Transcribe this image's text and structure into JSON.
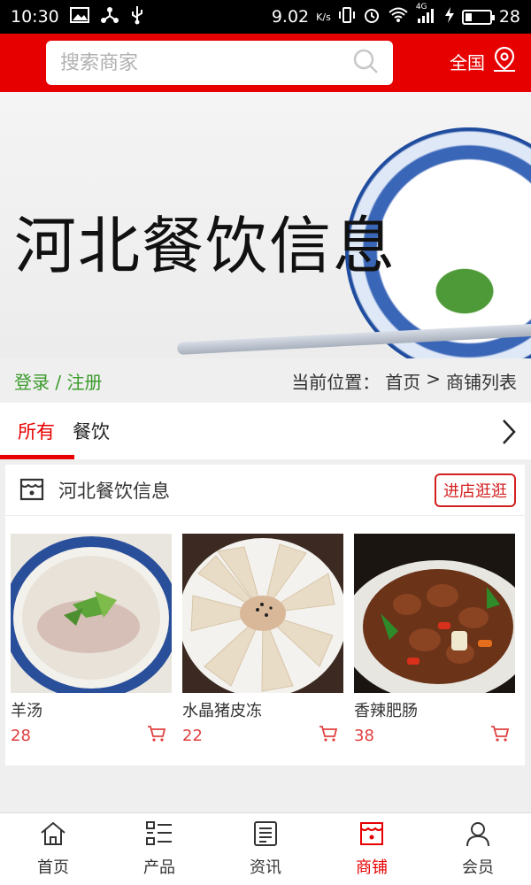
{
  "status_bar": {
    "time": "10:30",
    "speed": "9.02",
    "speed_unit": "K/s",
    "network": "4G",
    "battery": "28",
    "battery_level": 0.28
  },
  "header": {
    "search_placeholder": "搜索商家",
    "region_label": "全国"
  },
  "banner": {
    "title": "河北餐饮信息"
  },
  "breadcrumb": {
    "login_label": "登录 / 注册",
    "prefix": "当前位置：",
    "home": "首页",
    "separator": ">",
    "current": "商铺列表"
  },
  "tabs": [
    {
      "label": "所有",
      "active": true
    },
    {
      "label": "餐饮",
      "active": false
    }
  ],
  "shop": {
    "name": "河北餐饮信息",
    "enter_label": "进店逛逛",
    "products": [
      {
        "name": "羊汤",
        "price": "28",
        "image": "mutton-soup"
      },
      {
        "name": "水晶猪皮冻",
        "price": "22",
        "image": "pork-skin-jelly"
      },
      {
        "name": "香辣肥肠",
        "price": "38",
        "image": "spicy-intestines"
      }
    ]
  },
  "bottom_nav": [
    {
      "label": "首页",
      "icon": "home-icon",
      "active": false
    },
    {
      "label": "产品",
      "icon": "list-icon",
      "active": false
    },
    {
      "label": "资讯",
      "icon": "news-icon",
      "active": false
    },
    {
      "label": "商铺",
      "icon": "store-icon",
      "active": true
    },
    {
      "label": "会员",
      "icon": "user-icon",
      "active": false
    }
  ],
  "colors": {
    "brand": "#e60000",
    "login_green": "#3a9a2a",
    "price": "#e04040"
  }
}
